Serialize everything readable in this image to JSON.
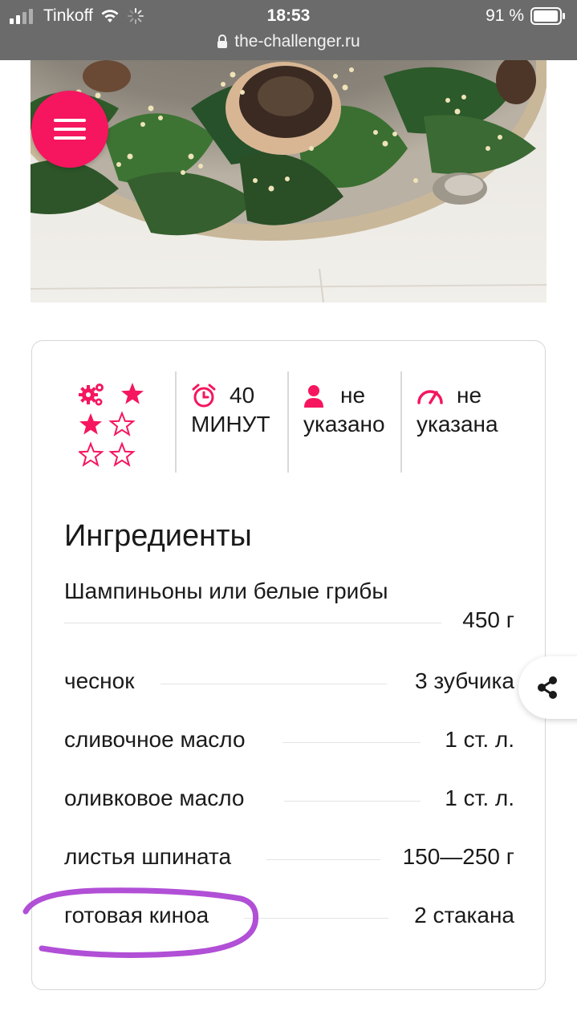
{
  "status_bar": {
    "carrier": "Tinkoff",
    "time": "18:53",
    "battery": "91 %",
    "url": "the-challenger.ru"
  },
  "hero": {
    "image": "dish-photo-quinoa-spinach-mushrooms"
  },
  "menu": {
    "icon": "hamburger-menu-icon"
  },
  "recipe_meta": {
    "difficulty_stars": 2,
    "difficulty_max": 5,
    "time_value": "40",
    "time_unit": "МИНУТ",
    "servings_line1": "не",
    "servings_line2": "указано",
    "calories_line1": "не",
    "calories_line2": "указана"
  },
  "ingredients": {
    "title": "Ингредиенты",
    "items": [
      {
        "name": "Шампиньоны или белые грибы",
        "amount": "450 г"
      },
      {
        "name": "чеснок",
        "amount": "3 зубчика"
      },
      {
        "name": "сливочное масло",
        "amount": "1 ст. л."
      },
      {
        "name": "оливковое масло",
        "amount": "1 ст. л."
      },
      {
        "name": "листья шпината",
        "amount": "150—250 г"
      },
      {
        "name": "готовая киноа",
        "amount": "2 стакана"
      }
    ]
  },
  "share": {
    "icon": "share-icon"
  },
  "colors": {
    "accent": "#f5165f",
    "annotation": "#b14fd6",
    "status_bar": "#6b6b6b"
  }
}
